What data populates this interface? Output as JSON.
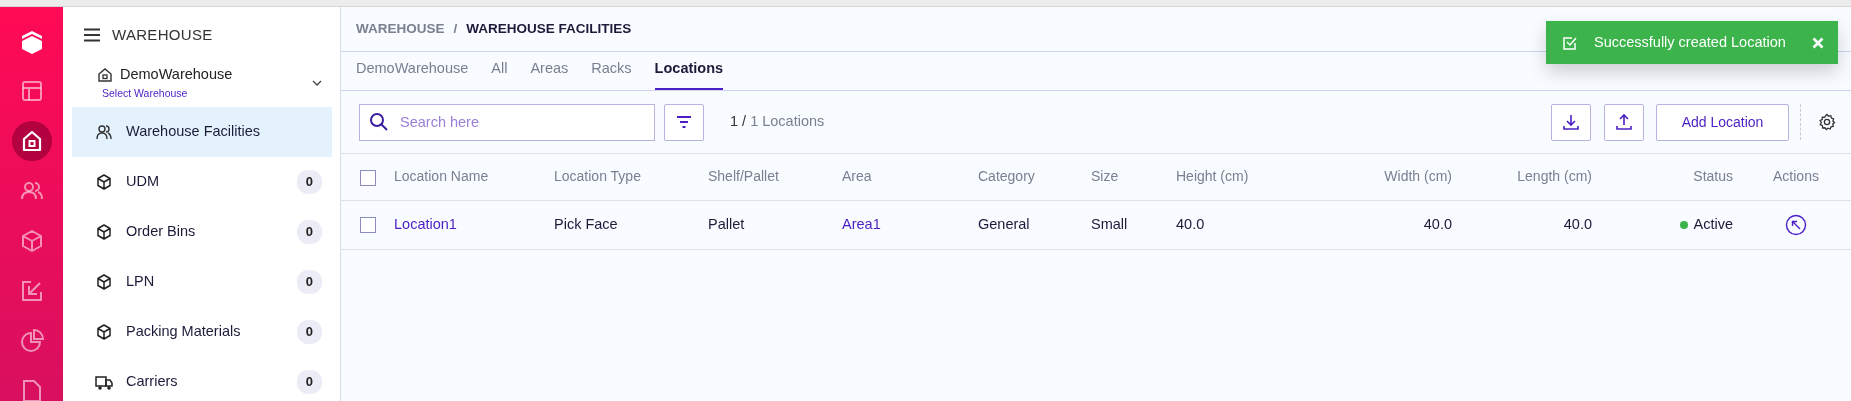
{
  "rail": [
    {
      "kind": "logo",
      "selected": false
    },
    {
      "kind": "layout",
      "selected": false
    },
    {
      "kind": "home",
      "selected": true
    },
    {
      "kind": "users",
      "selected": false
    },
    {
      "kind": "box",
      "selected": false
    },
    {
      "kind": "inbound",
      "selected": false
    },
    {
      "kind": "pie",
      "selected": false
    },
    {
      "kind": "document",
      "selected": false
    }
  ],
  "sidebar": {
    "title": "WAREHOUSE",
    "warehouse": {
      "name": "DemoWarehouse",
      "hint": "Select Warehouse"
    },
    "items": [
      {
        "kind": "users",
        "label": "Warehouse Facilities",
        "selected": true
      },
      {
        "kind": "box",
        "label": "UDM",
        "count": "0",
        "selected": false
      },
      {
        "kind": "box",
        "label": "Order Bins",
        "count": "0",
        "selected": false
      },
      {
        "kind": "box",
        "label": "LPN",
        "count": "0",
        "selected": false
      },
      {
        "kind": "box",
        "label": "Packing Materials",
        "count": "0",
        "selected": false
      },
      {
        "kind": "truck",
        "label": "Carriers",
        "count": "0",
        "selected": false
      }
    ]
  },
  "breadcrumb": {
    "parts": [
      "WAREHOUSE",
      "WAREHOUSE FACILITIES"
    ],
    "separator": "/"
  },
  "tabs": [
    {
      "label": "DemoWarehouse",
      "selected": false
    },
    {
      "label": "All",
      "selected": false
    },
    {
      "label": "Areas",
      "selected": false
    },
    {
      "label": "Racks",
      "selected": false
    },
    {
      "label": "Locations",
      "selected": true
    }
  ],
  "search": {
    "placeholder": "Search here"
  },
  "count": {
    "shown": "1 /",
    "total": "1 Locations"
  },
  "add_button": "Add Location",
  "toast": {
    "text": "Successfully created Location"
  },
  "table": {
    "select_all_checked": false,
    "columns": [
      "Location Name",
      "Location Type",
      "Shelf/Pallet",
      "Area",
      "Category",
      "Size",
      "Height (cm)",
      "Width (cm)",
      "Length (cm)",
      "Status",
      "Actions"
    ],
    "rows": [
      {
        "checked": false,
        "cells": [
          "Location1",
          "Pick Face",
          "Pallet",
          "Area1",
          "General",
          "Small",
          "40.0",
          "40.0",
          "40.0"
        ],
        "status": {
          "text": "Active",
          "color": "#3cb44b"
        }
      }
    ]
  }
}
